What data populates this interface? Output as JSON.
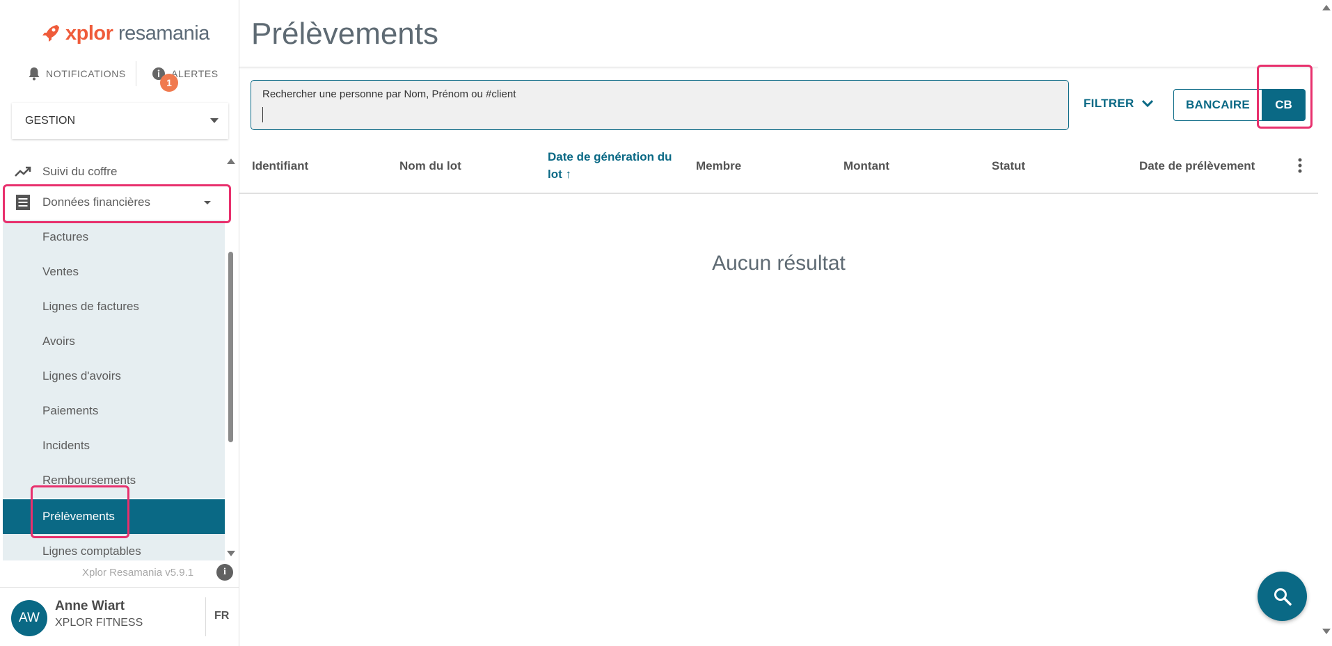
{
  "brand": {
    "logo_prefix": "xplor",
    "logo_suffix": "resamania",
    "accent": "#0a6985",
    "logo_color": "#ef5b3a",
    "highlight": "#e8306d"
  },
  "topnav": {
    "notifications": "NOTIFICATIONS",
    "alerts": "ALERTES",
    "alerts_badge": "1"
  },
  "gestion_select": {
    "value": "GESTION"
  },
  "sidebar": {
    "items": [
      {
        "label": "Suivi du coffre",
        "icon": "trending-up-icon"
      },
      {
        "label": "Données financières",
        "icon": "receipt-icon"
      },
      {
        "label": "Factures"
      },
      {
        "label": "Ventes"
      },
      {
        "label": "Lignes de factures"
      },
      {
        "label": "Avoirs"
      },
      {
        "label": "Lignes d'avoirs"
      },
      {
        "label": "Paiements"
      },
      {
        "label": "Incidents"
      },
      {
        "label": "Remboursements"
      },
      {
        "label": "Prélèvements"
      },
      {
        "label": "Lignes comptables"
      }
    ],
    "version": "Xplor Resamania v5.9.1"
  },
  "user": {
    "initials": "AW",
    "name": "Anne Wiart",
    "org": "XPLOR FITNESS",
    "lang": "FR"
  },
  "page": {
    "title": "Prélèvements"
  },
  "search": {
    "label": "Rechercher une personne par Nom, Prénom ou #client",
    "value": ""
  },
  "toolbar": {
    "filter_label": "FILTRER",
    "bancaire_label": "BANCAIRE",
    "cb_label": "CB"
  },
  "table": {
    "columns": [
      {
        "label": "Identifiant"
      },
      {
        "label": "Nom du lot"
      },
      {
        "label": "Date de génération du",
        "label_line2": "lot ↑",
        "sorted": true
      },
      {
        "label": "Membre"
      },
      {
        "label": "Montant"
      },
      {
        "label": "Statut"
      },
      {
        "label": "Date de prélèvement"
      }
    ],
    "empty_message": "Aucun résultat"
  }
}
